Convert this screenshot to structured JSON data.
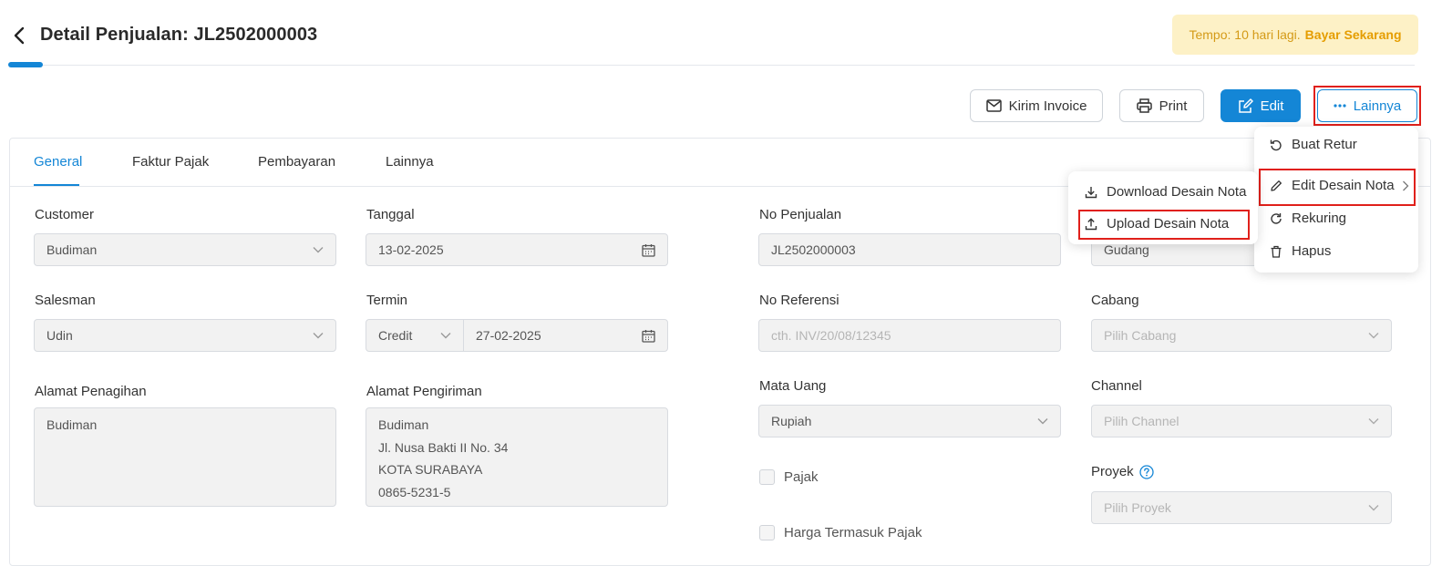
{
  "header": {
    "title": "Detail Penjualan: JL2502000003",
    "banner_text": "Tempo: 10 hari lagi.",
    "banner_action": "Bayar Sekarang"
  },
  "toolbar": {
    "send_invoice": "Kirim Invoice",
    "print": "Print",
    "edit": "Edit",
    "more": "Lainnya"
  },
  "more_menu": {
    "items": [
      "Buat Retur",
      "Edit Desain Nota",
      "Rekuring",
      "Hapus"
    ]
  },
  "desain_submenu": {
    "items": [
      "Download Desain Nota",
      "Upload Desain Nota"
    ]
  },
  "tabs": [
    "General",
    "Faktur Pajak",
    "Pembayaran",
    "Lainnya"
  ],
  "form": {
    "customer": {
      "label": "Customer",
      "value": "Budiman"
    },
    "tanggal": {
      "label": "Tanggal",
      "value": "13-02-2025"
    },
    "no_penjualan": {
      "label": "No Penjualan",
      "value": "JL2502000003"
    },
    "gudang": {
      "value": "Gudang"
    },
    "salesman": {
      "label": "Salesman",
      "value": "Udin"
    },
    "termin": {
      "label": "Termin",
      "type": "Credit",
      "date": "27-02-2025"
    },
    "no_referensi": {
      "label": "No Referensi",
      "placeholder": "cth. INV/20/08/12345"
    },
    "cabang": {
      "label": "Cabang",
      "placeholder": "Pilih Cabang"
    },
    "alamat_penagihan": {
      "label": "Alamat Penagihan",
      "lines": [
        "Budiman"
      ]
    },
    "alamat_pengiriman": {
      "label": "Alamat Pengiriman",
      "lines": [
        "Budiman",
        "Jl. Nusa Bakti II No. 34",
        "KOTA SURABAYA",
        "0865-5231-5"
      ]
    },
    "mata_uang": {
      "label": "Mata Uang",
      "value": "Rupiah"
    },
    "channel": {
      "label": "Channel",
      "placeholder": "Pilih Channel"
    },
    "pajak": {
      "label": "Pajak"
    },
    "proyek": {
      "label": "Proyek",
      "placeholder": "Pilih Proyek"
    },
    "harga_termasuk_pajak": {
      "label": "Harga Termasuk Pajak"
    }
  },
  "colors": {
    "accent": "#1486d6",
    "highlight": "#e0201b",
    "banner_bg": "#fdf1c6",
    "banner_text": "#d49a17"
  },
  "icons": [
    "back-icon",
    "mail-icon",
    "printer-icon",
    "edit-icon",
    "ellipsis-icon",
    "undo-icon",
    "pencil-icon",
    "chevron-right-icon",
    "refresh-icon",
    "trash-icon",
    "download-icon",
    "upload-icon",
    "calendar-icon",
    "chevron-down-icon",
    "help-icon"
  ]
}
